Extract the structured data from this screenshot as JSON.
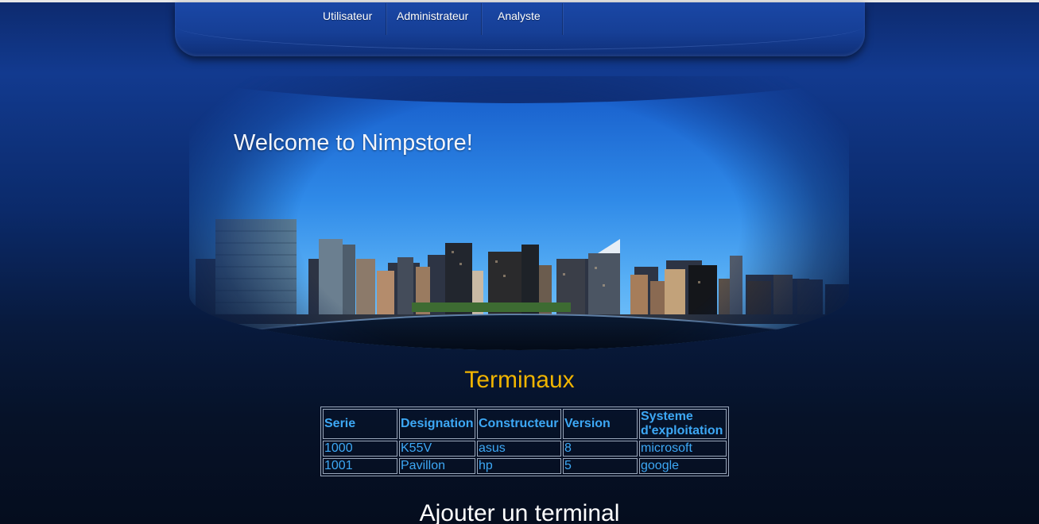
{
  "nav": {
    "items": [
      {
        "label": "Utilisateur"
      },
      {
        "label": "Administrateur"
      },
      {
        "label": "Analyste"
      }
    ]
  },
  "banner": {
    "title": "Welcome to Nimpstore!"
  },
  "terminals": {
    "heading": "Terminaux",
    "columns": [
      "Serie",
      "Designation",
      "Constructeur",
      "Version",
      "Systeme d'exploitation"
    ],
    "rows": [
      [
        "1000",
        "K55V",
        "asus",
        "8",
        "microsoft"
      ],
      [
        "1001",
        "Pavillon",
        "hp",
        "5",
        "google"
      ]
    ]
  },
  "add_section": {
    "heading": "Ajouter un terminal"
  },
  "colors": {
    "heading_accent": "#f0b400",
    "table_text": "#3da8f5",
    "background_dark": "#061228",
    "background_blue": "#123a8f"
  }
}
